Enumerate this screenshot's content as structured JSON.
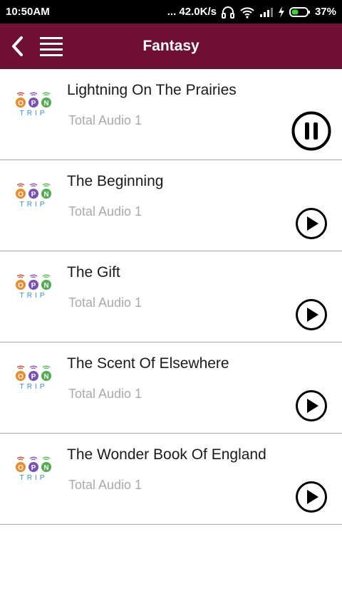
{
  "status_bar": {
    "time": "10:50AM",
    "speed": "... 42.0K/s",
    "battery": "37%",
    "icons": [
      "headphones-icon",
      "wifi-icon",
      "signal-icon",
      "charging-icon",
      "battery-icon"
    ]
  },
  "app_bar": {
    "title": "Fantasy",
    "color": "#6f0f33"
  },
  "logo_text": {
    "letters": "OPN",
    "sub": "TRIP"
  },
  "items": [
    {
      "title": "Lightning On The Prairies",
      "subtitle": "Total Audio 1",
      "state": "pause-icon"
    },
    {
      "title": "The Beginning",
      "subtitle": "Total Audio 1",
      "state": "play-icon"
    },
    {
      "title": "The Gift",
      "subtitle": "Total Audio 1",
      "state": "play-icon"
    },
    {
      "title": "The Scent Of Elsewhere",
      "subtitle": "Total Audio 1",
      "state": "play-icon"
    },
    {
      "title": "The Wonder Book Of England",
      "subtitle": "Total Audio 1",
      "state": "play-icon"
    }
  ]
}
